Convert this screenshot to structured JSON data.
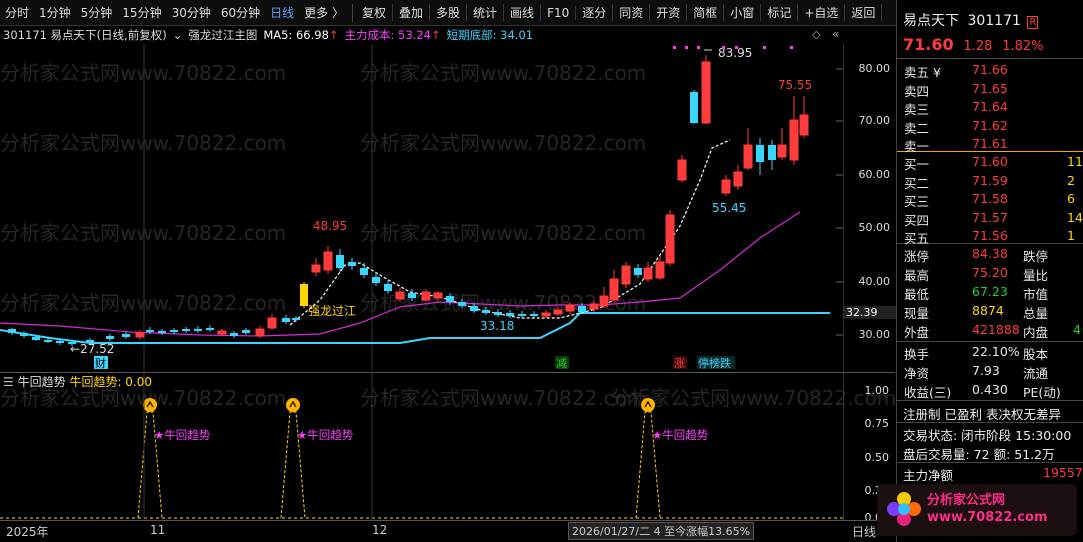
{
  "toolbar": {
    "periods": [
      "分时",
      "1分钟",
      "5分钟",
      "15分钟",
      "30分钟",
      "60分钟",
      "日线",
      "更多 〉"
    ],
    "active": "日线",
    "buttons": [
      "复权",
      "叠加",
      "多股",
      "统计",
      "画线",
      "F10",
      "逐分",
      "同资",
      "开资",
      "简框",
      "小窗",
      "标记",
      "+自选",
      "返回"
    ]
  },
  "chart_header": {
    "code_name": "301171 易点天下(日线,前复权)",
    "indicator": "强龙过江主图",
    "ma5": "MA5: 66.98",
    "main_cost": "主力成本: 53.24",
    "bottom": "短期底部: 34.01",
    "up_arrow": "↑"
  },
  "y_axis_main": [
    "80.00",
    "70.00",
    "60.00",
    "50.00",
    "40.00",
    "30.00"
  ],
  "y_axis_main_current": "32.39",
  "y_axis_sub": [
    "1.00",
    "0.75",
    "0.50",
    "0.25",
    "0.00"
  ],
  "x_axis": [
    "2025年",
    "11",
    "12",
    "2026/01/27/二 4 至今涨幅13.65%",
    "日线"
  ],
  "annotations": {
    "high1": "48.95",
    "high2": "83.95",
    "high3": "75.55",
    "low1": "←27.52",
    "low2": "33.18",
    "low3": "55.45",
    "signal": "强龙过江",
    "cai": "财",
    "jian": "减",
    "zhang": "涨",
    "tingbang": "停榜跌"
  },
  "sub_header": {
    "name": "牛回趋势",
    "value": "牛回趋势: 0.00",
    "signal_label": "★牛回趋势"
  },
  "watermark": "分析家公式网www.70822.com",
  "logo": "分析家公式网 www.70822.com",
  "quote": {
    "name": "易点天下",
    "code": "301171",
    "tag": "R",
    "price": "71.60",
    "change": "1.28",
    "pct": "1.82%",
    "asks": [
      {
        "label": "卖五 ¥",
        "price": "71.66"
      },
      {
        "label": "卖四",
        "price": "71.65"
      },
      {
        "label": "卖三",
        "price": "71.64"
      },
      {
        "label": "卖二",
        "price": "71.62"
      },
      {
        "label": "卖一",
        "price": "71.61"
      }
    ],
    "bids": [
      {
        "label": "买一",
        "price": "71.60",
        "vol": "11"
      },
      {
        "label": "买二",
        "price": "71.59",
        "vol": "2"
      },
      {
        "label": "买三",
        "price": "71.58",
        "vol": "6"
      },
      {
        "label": "买四",
        "price": "71.57",
        "vol": "14"
      },
      {
        "label": "买五",
        "price": "71.56",
        "vol": "1"
      }
    ],
    "stats": [
      {
        "l1": "涨停",
        "v1": "84.38",
        "c1": "red",
        "l2": "跌停",
        "v2": "",
        "c2": "green"
      },
      {
        "l1": "最高",
        "v1": "75.20",
        "c1": "red",
        "l2": "量比",
        "v2": "",
        "c2": "white"
      },
      {
        "l1": "最低",
        "v1": "67.23",
        "c1": "green",
        "l2": "市值",
        "v2": "",
        "c2": "white"
      },
      {
        "l1": "现量",
        "v1": "8874",
        "c1": "yellow",
        "l2": "总量",
        "v2": "",
        "c2": "white"
      },
      {
        "l1": "外盘",
        "v1": "421888",
        "c1": "red",
        "l2": "内盘",
        "v2": "4",
        "c2": "green"
      }
    ],
    "stats2": [
      {
        "l1": "换手",
        "v1": "22.10%",
        "l2": "股本"
      },
      {
        "l1": "净资",
        "v1": "7.93",
        "l2": "流通"
      },
      {
        "l1": "收益(三)",
        "v1": "0.430",
        "l2": "PE(动)"
      }
    ],
    "reg": "注册制 已盈利 表决权无差异",
    "trade_status": "交易状态: 闭市阶段 15:30:00",
    "after_hours": "盘后交易量: 72  额: 51.2万",
    "main_net_label": "主力净额",
    "main_net_value": "19557"
  }
}
